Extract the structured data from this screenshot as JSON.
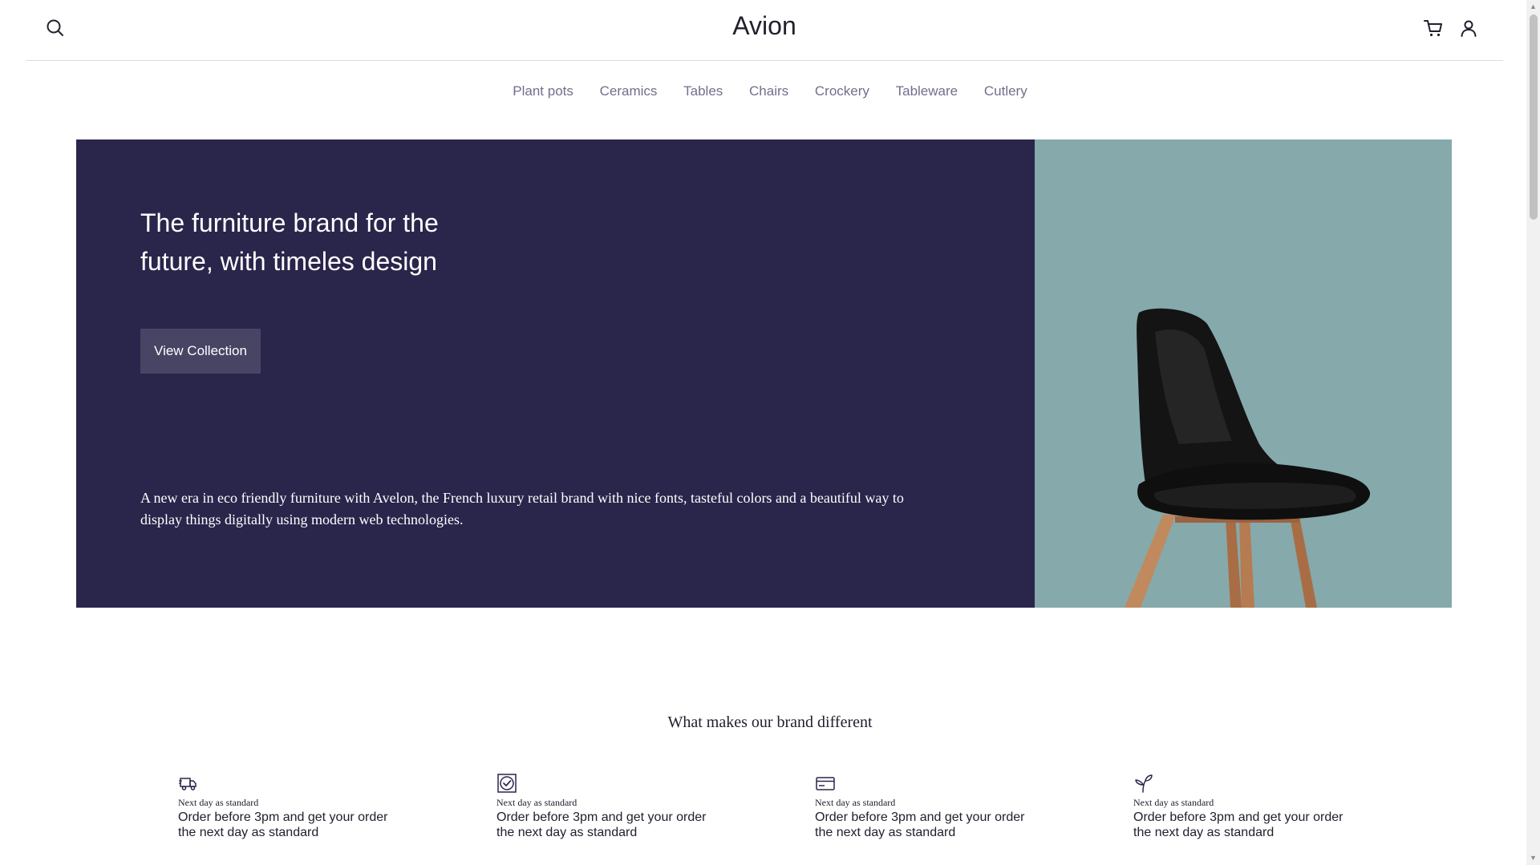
{
  "header": {
    "brand": "Avion",
    "icons": [
      "search-icon",
      "cart-icon",
      "user-icon"
    ]
  },
  "categories": [
    "Plant pots",
    "Ceramics",
    "Tables",
    "Chairs",
    "Crockery",
    "Tableware",
    "Cutlery"
  ],
  "hero": {
    "title": "The furniture brand for the future, with timeles design",
    "cta_label": "View Collection",
    "description": "A new era in eco friendly furniture with Avelon, the French luxury retail brand with nice fonts, tasteful colors and a beautiful way to display things digitally using modern web technologies.",
    "colors": {
      "panel": "#2a254b",
      "image_bg": "#86a9ab"
    }
  },
  "features": {
    "title": "What makes our brand different",
    "items": [
      {
        "icon": "delivery-truck-icon",
        "heading": "Next day as standard",
        "body": "Order before 3pm and get your order the next day as standard"
      },
      {
        "icon": "checkmark-badge-icon",
        "heading": "Next day as standard",
        "body": "Order before 3pm and get your order the next day as standard"
      },
      {
        "icon": "credit-card-icon",
        "heading": "Next day as standard",
        "body": "Order before 3pm and get your order the next day as standard"
      },
      {
        "icon": "plant-sprout-icon",
        "heading": "Next day as standard",
        "body": "Order before 3pm and get your order the next day as standard"
      }
    ]
  }
}
